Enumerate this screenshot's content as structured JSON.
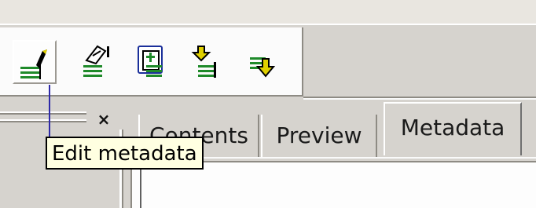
{
  "toolbar": {
    "buttons": [
      {
        "name": "edit-metadata-icon",
        "pressed": true
      },
      {
        "name": "properties-icon",
        "pressed": false
      },
      {
        "name": "add-item-icon",
        "pressed": false
      },
      {
        "name": "move-up-icon",
        "pressed": false
      },
      {
        "name": "move-down-icon",
        "pressed": false
      }
    ]
  },
  "left_pane": {
    "close_label": "×"
  },
  "tabs": [
    {
      "label": "Contents",
      "active": false
    },
    {
      "label": "Preview",
      "active": false
    },
    {
      "label": "Metadata",
      "active": true
    }
  ],
  "tooltip": {
    "text": "Edit metadata"
  },
  "colors": {
    "tooltip_bg": "#ffffe1",
    "icon_green": "#1f8a2a",
    "icon_yellow": "#e0d000",
    "tooltip_leader": "#2e2aa8"
  }
}
